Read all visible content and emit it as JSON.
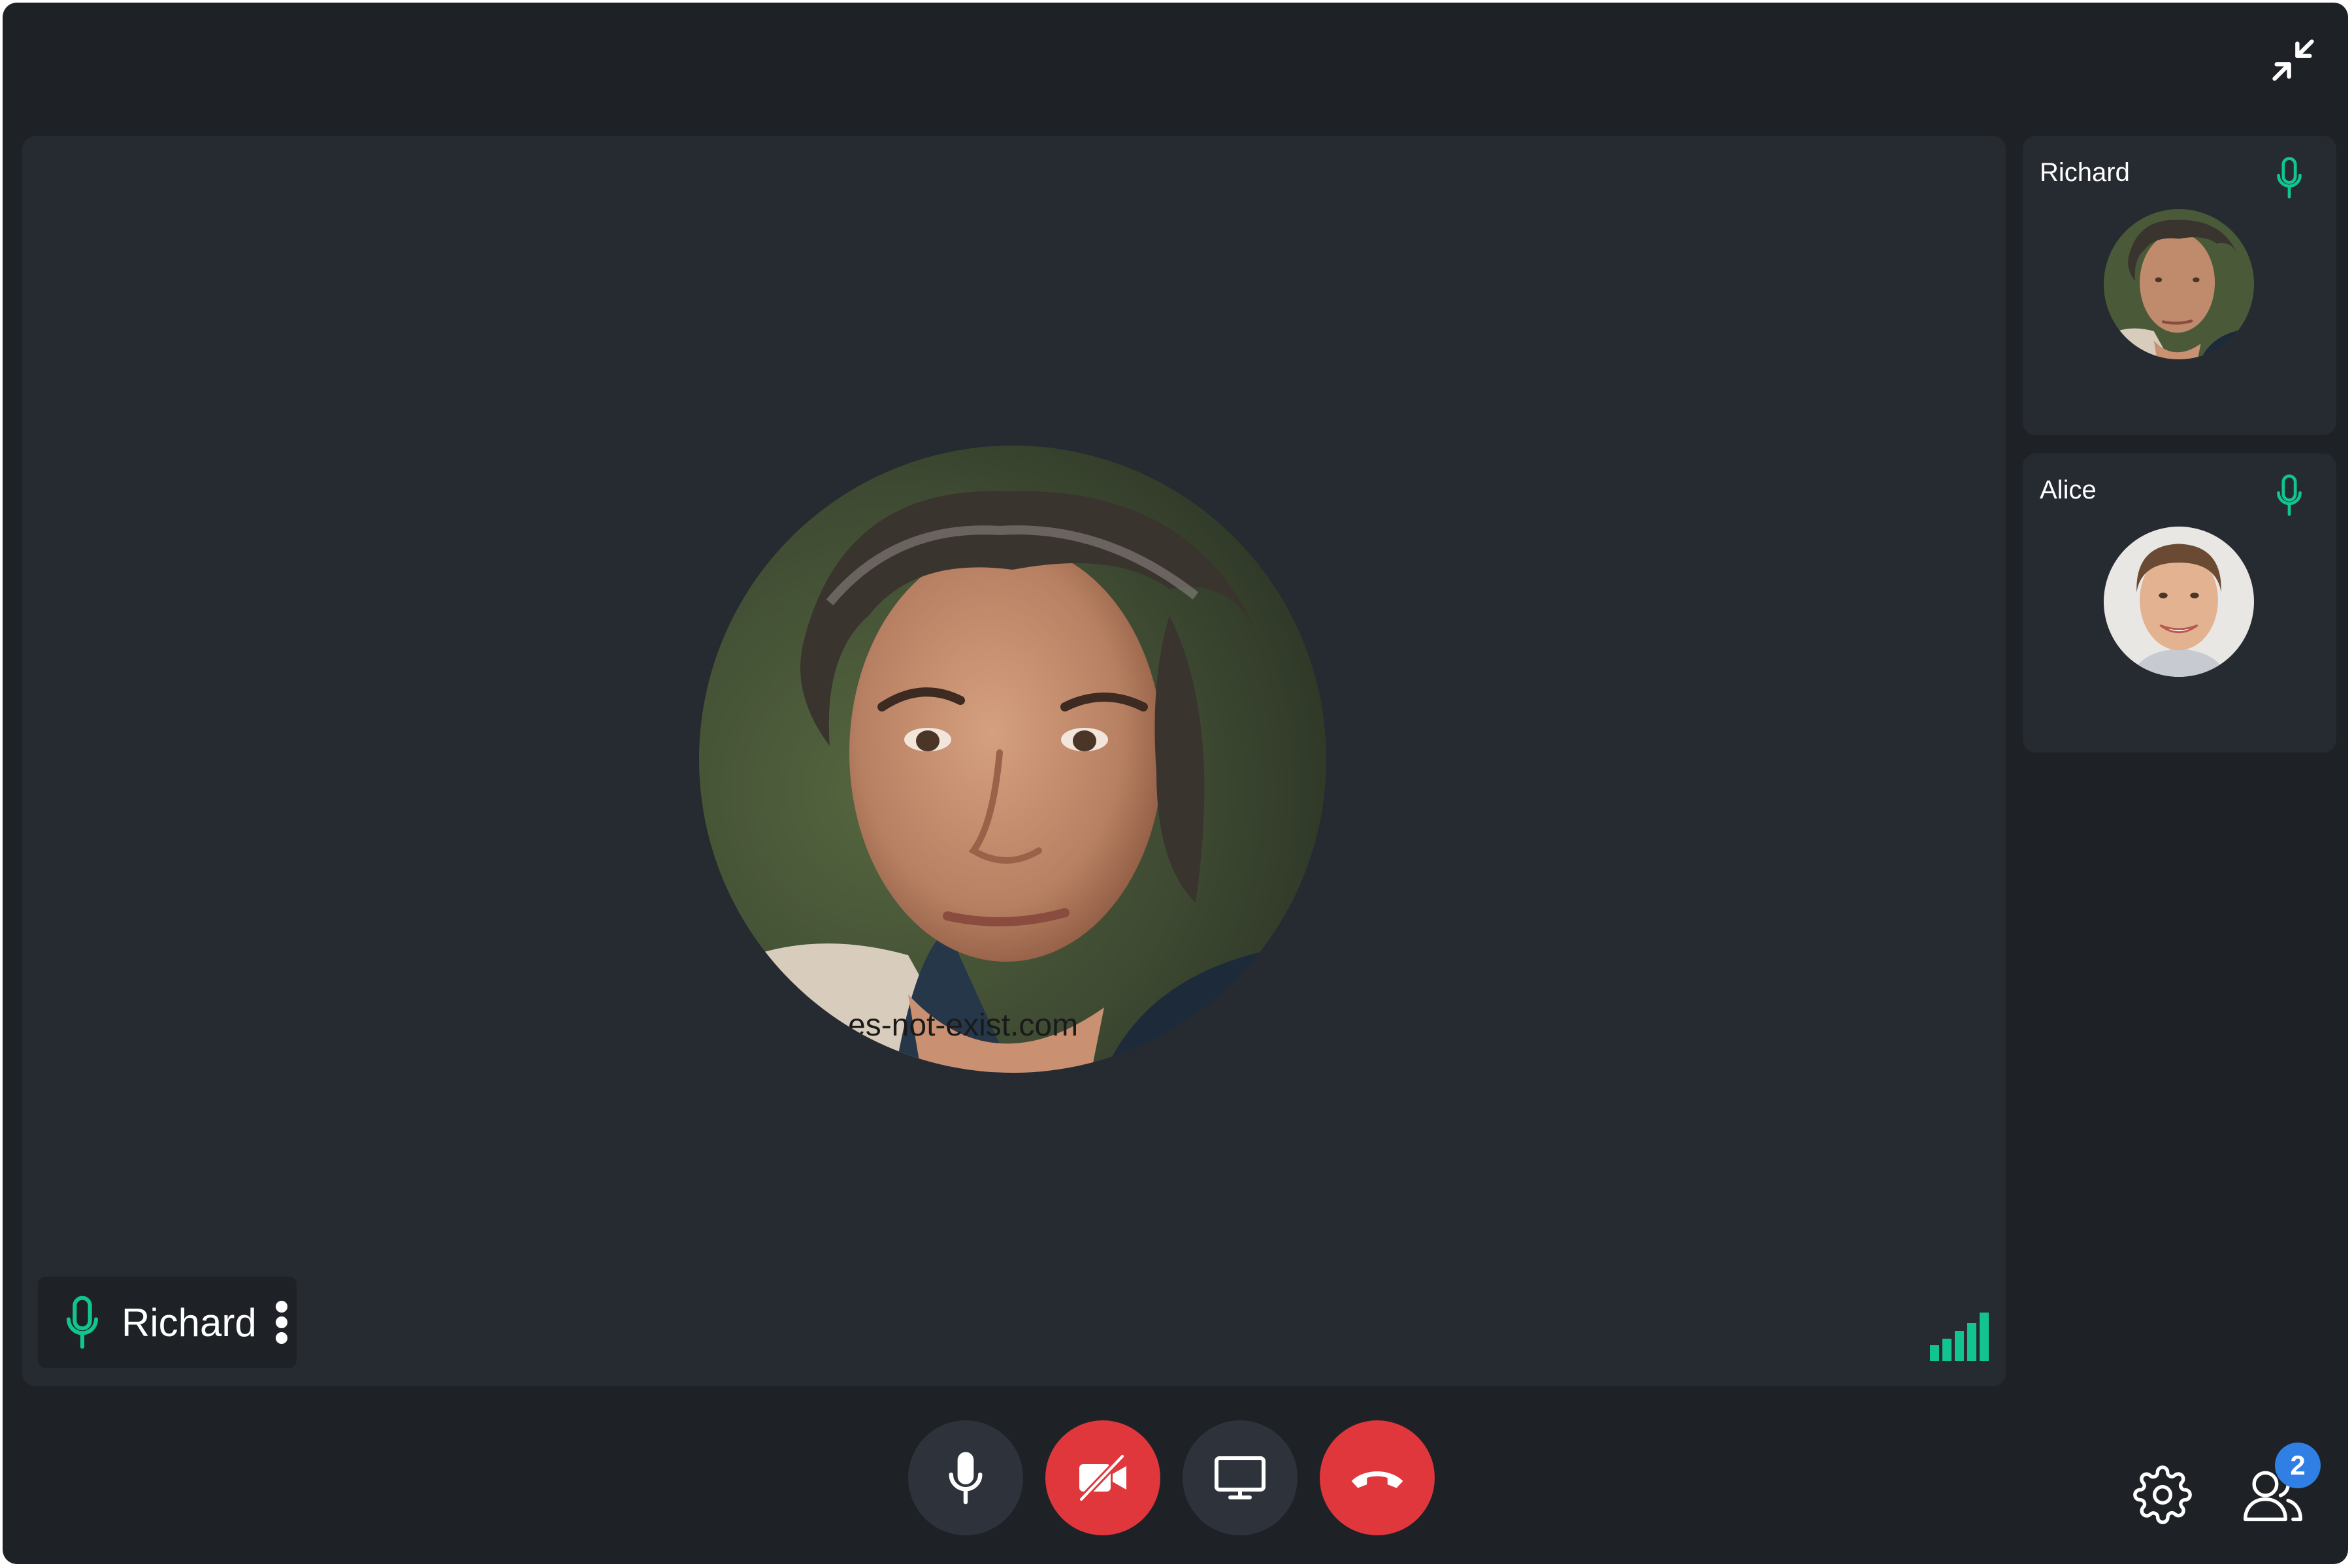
{
  "colors": {
    "window_bg": "#1e2227",
    "stage_bg": "#262a31",
    "accent_green": "#12c48f",
    "danger_red": "#e0373c",
    "badge_blue": "#2f7fe4"
  },
  "header": {
    "collapse_icon": "collapse-arrows-icon"
  },
  "main": {
    "speaker_name": "Richard",
    "watermark": "es-not-exist.com",
    "signal_strength_bars": 5,
    "icons": [
      "mic-icon",
      "more-vertical-icon",
      "signal-bars-icon"
    ]
  },
  "participants": [
    {
      "name": "Richard",
      "icon": "mic-icon"
    },
    {
      "name": "Alice",
      "icon": "mic-icon"
    }
  ],
  "controls": [
    {
      "name": "microphone",
      "icon": "mic-icon",
      "state": "on"
    },
    {
      "name": "camera",
      "icon": "video-camera-icon",
      "state": "off"
    },
    {
      "name": "share-screen",
      "icon": "monitor-icon",
      "state": "off"
    },
    {
      "name": "end-call",
      "icon": "phone-hangup-icon",
      "state": "active"
    }
  ],
  "footer": {
    "settings_icon": "gear-icon",
    "participants_icon": "users-icon",
    "participant_count": "2"
  }
}
